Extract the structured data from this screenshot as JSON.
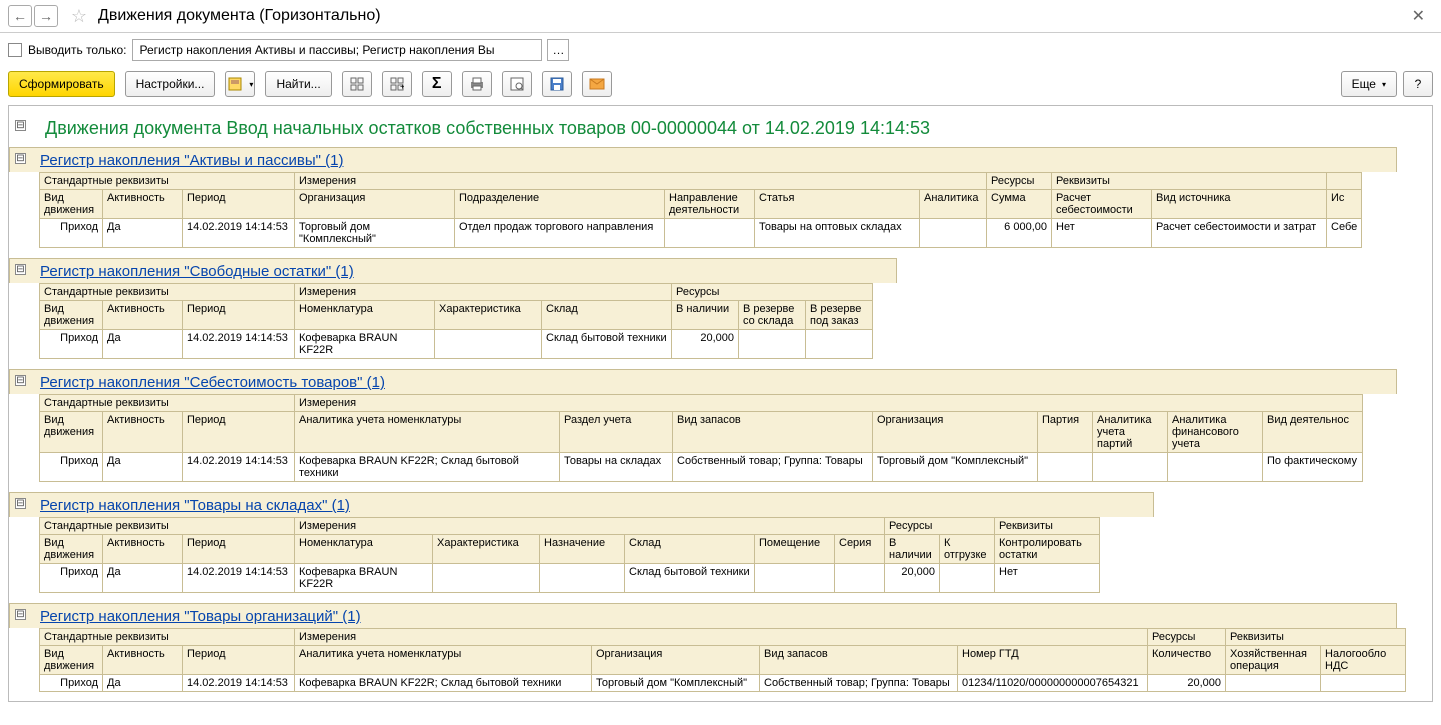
{
  "title": "Движения документа (Горизонтально)",
  "filter": {
    "label": "Выводить только:",
    "value": "Регистр накопления Активы и пассивы; Регистр накопления Вы"
  },
  "toolbar": {
    "form": "Сформировать",
    "settings": "Настройки...",
    "find": "Найти...",
    "more": "Еще",
    "collapse": "⊟"
  },
  "report_title": "Движения документа Ввод начальных остатков собственных товаров 00-00000044 от 14.02.2019 14:14:53",
  "hdr": {
    "std": "Стандартные реквизиты",
    "dim": "Измерения",
    "res": "Ресурсы",
    "attr": "Реквизиты",
    "kind": "Вид движения",
    "active": "Активность",
    "period": "Период",
    "org": "Организация",
    "dept": "Подразделение",
    "dir": "Направление деятельности",
    "art": "Статья",
    "anal": "Аналитика",
    "sum": "Сумма",
    "calc": "Расчет себестоимости",
    "src": "Вид источника",
    "isrc": "Ис",
    "nom": "Номенклатура",
    "char": "Характеристика",
    "whs": "Склад",
    "avail": "В наличии",
    "resw": "В резерве со склада",
    "resz": "В резерве под заказ",
    "anom": "Аналитика учета номенклатуры",
    "sect": "Раздел учета",
    "stock": "Вид запасов",
    "party": "Партия",
    "ap": "Аналитика учета партий",
    "af": "Аналитика финансового учета",
    "act": "Вид деятельнос",
    "assign": "Назначение",
    "room": "Помещение",
    "ser": "Серия",
    "ship": "К отгрузке",
    "ctrl": "Контролировать остатки",
    "gtd": "Номер ГТД",
    "qty": "Количество",
    "hop": "Хозяйственная операция",
    "vat": "Налогообло НДС"
  },
  "v": {
    "in": "Приход",
    "yes": "Да",
    "no": "Нет",
    "dt": "14.02.2019 14:14:53",
    "td": "Торговый дом \"Комплексный\"",
    "dept": "Отдел продаж торгового направления",
    "art": "Товары на оптовых складах",
    "sum": "6 000,00",
    "calc": "Расчет себестоимости и затрат",
    "src": "Себе",
    "nom": "Кофеварка BRAUN KF22R",
    "whs": "Склад бытовой техники",
    "q20": "20,000",
    "anom": "Кофеварка BRAUN KF22R; Склад бытовой техники",
    "sect": "Товары на складах",
    "stock": "Собственный товар; Группа: Товары",
    "act": "По фактическому",
    "gtd": "01234/11020/000000000007654321"
  },
  "reg": {
    "r1": "Регистр накопления \"Активы и пассивы\" (1)",
    "r2": "Регистр накопления \"Свободные остатки\" (1)",
    "r3": "Регистр накопления \"Себестоимость товаров\" (1)",
    "r4": "Регистр накопления \"Товары на складах\" (1)",
    "r5": "Регистр накопления \"Товары организаций\" (1)"
  }
}
